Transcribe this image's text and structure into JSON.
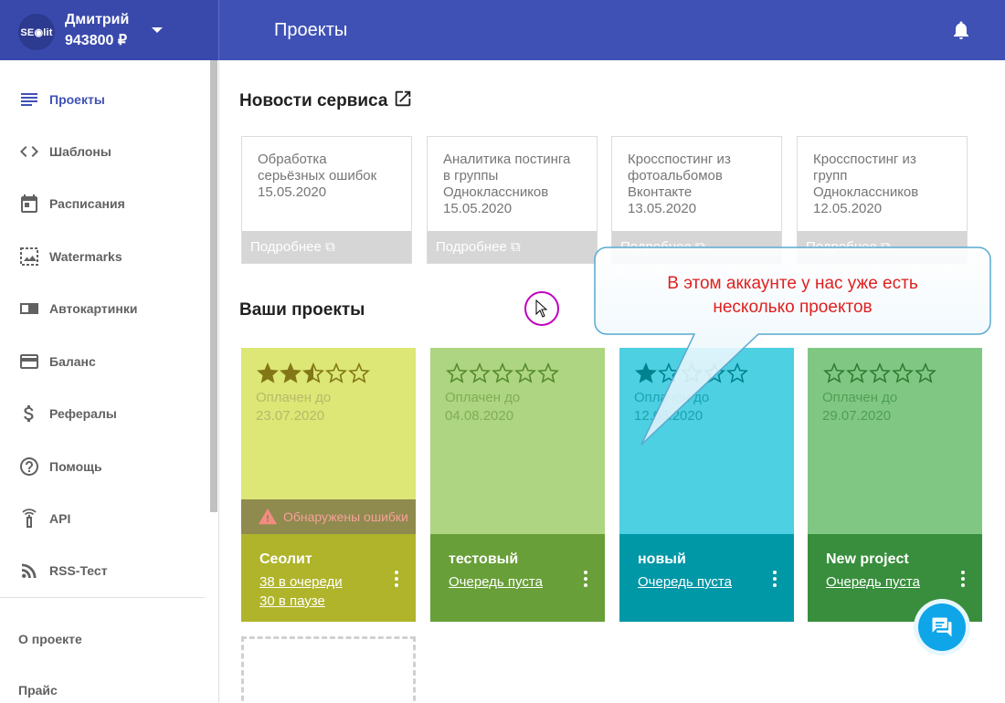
{
  "user": {
    "avatar_text": "SE◉lit",
    "name": "Дмитрий",
    "balance": "943800 ₽"
  },
  "header": {
    "title": "Проекты"
  },
  "sidebar": {
    "items": [
      {
        "label": "Проекты",
        "icon": "list-icon",
        "active": true
      },
      {
        "label": "Шаблоны",
        "icon": "code-icon"
      },
      {
        "label": "Расписания",
        "icon": "calendar-icon"
      },
      {
        "label": "Watermarks",
        "icon": "image-icon"
      },
      {
        "label": "Автокартинки",
        "icon": "badge-icon"
      },
      {
        "label": "Баланс",
        "icon": "credit-card-icon"
      },
      {
        "label": "Рефералы",
        "icon": "dollar-icon"
      },
      {
        "label": "Помощь",
        "icon": "help-icon"
      },
      {
        "label": "API",
        "icon": "api-icon"
      },
      {
        "label": "RSS-Тест",
        "icon": "rss-icon"
      }
    ],
    "links": [
      "О проекте",
      "Прайс"
    ]
  },
  "news": {
    "title": "Новости сервиса",
    "more_label": "Подробнее",
    "cards": [
      {
        "lines": [
          "Обработка",
          "серьёзных ошибок"
        ],
        "date": "15.05.2020"
      },
      {
        "lines": [
          "Аналитика постинга",
          "в группы",
          "Одноклассников"
        ],
        "date": "15.05.2020"
      },
      {
        "lines": [
          "Кросспостинг из",
          "фотоальбомов",
          "Вконтакте"
        ],
        "date": "13.05.2020"
      },
      {
        "lines": [
          "Кросспостинг из",
          "групп",
          "Одноклассников"
        ],
        "date": "12.05.2020"
      }
    ]
  },
  "projects": {
    "title": "Ваши проекты",
    "paid_label": "Оплачен до",
    "items": [
      {
        "name": "Сеолит",
        "rating": 2.5,
        "paid_until": "23.07.2020",
        "links": [
          "38 в очереди",
          "30 в паузе"
        ],
        "error": "Обнаружены ошибки",
        "top_color": "#dce775",
        "bottom_color": "#afb42b",
        "text_color": "#b8b96a",
        "star_color": "#827717"
      },
      {
        "name": "тестовый",
        "rating": 0,
        "paid_until": "04.08.2020",
        "links": [
          "Очередь пуста"
        ],
        "top_color": "#aed581",
        "bottom_color": "#689f38",
        "text_color": "#7fae55",
        "star_color": "#558b2f"
      },
      {
        "name": "новый",
        "rating": 1,
        "paid_until": "12.08.2020",
        "links": [
          "Очередь пуста"
        ],
        "top_color": "#4dd0e1",
        "bottom_color": "#0097a7",
        "text_color": "#1aa3b3",
        "star_color": "#00838f"
      },
      {
        "name": "New project",
        "rating": 0,
        "paid_until": "29.07.2020",
        "links": [
          "Очередь пуста"
        ],
        "top_color": "#81c784",
        "bottom_color": "#388e3c",
        "text_color": "#4f9f54",
        "star_color": "#2e7d32"
      }
    ]
  },
  "callout": {
    "lines": [
      "В этом аккаунте у нас уже есть",
      "несколько проектов"
    ]
  }
}
